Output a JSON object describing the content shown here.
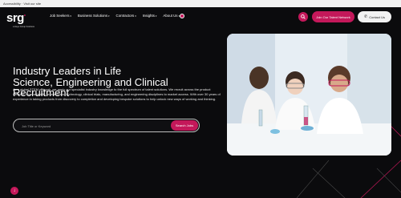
{
  "topbar": {
    "text": "Accessibility  ·  Visit our site"
  },
  "brand": {
    "name": "srg",
    "tagline": "a Hays Group business",
    "accent": "#c4185a"
  },
  "nav": {
    "items": [
      {
        "label": "Job Seekers"
      },
      {
        "label": "Business Solutions"
      },
      {
        "label": "Contractors"
      },
      {
        "label": "Insights"
      },
      {
        "label": "About Us"
      }
    ]
  },
  "actions": {
    "join_talent": "Join Our Talent Network",
    "contact": "Contact Us"
  },
  "hero": {
    "headline_line1": "Industry Leaders in Life",
    "headline_line2": "Science, Engineering and Clinical Recruitment",
    "description": "As a global STEM network, we apply our specialist industry knowledge to the full spectrum of talent solutions. We recruit across the product lifecycle, from scientific research and technology, clinical trials, manufacturing, and engineering disciplines to market access. With over 30 years of experience in taking products from discovery to completion and developing bespoke solutions to help unlock new ways of working and thinking."
  },
  "search": {
    "placeholder": "Job Title or Keyword",
    "button": "Search Jobs"
  },
  "icons": {
    "search": "search-icon",
    "phone": "phone-icon",
    "globe": "globe-icon",
    "scroll": "arrow-down-icon"
  }
}
